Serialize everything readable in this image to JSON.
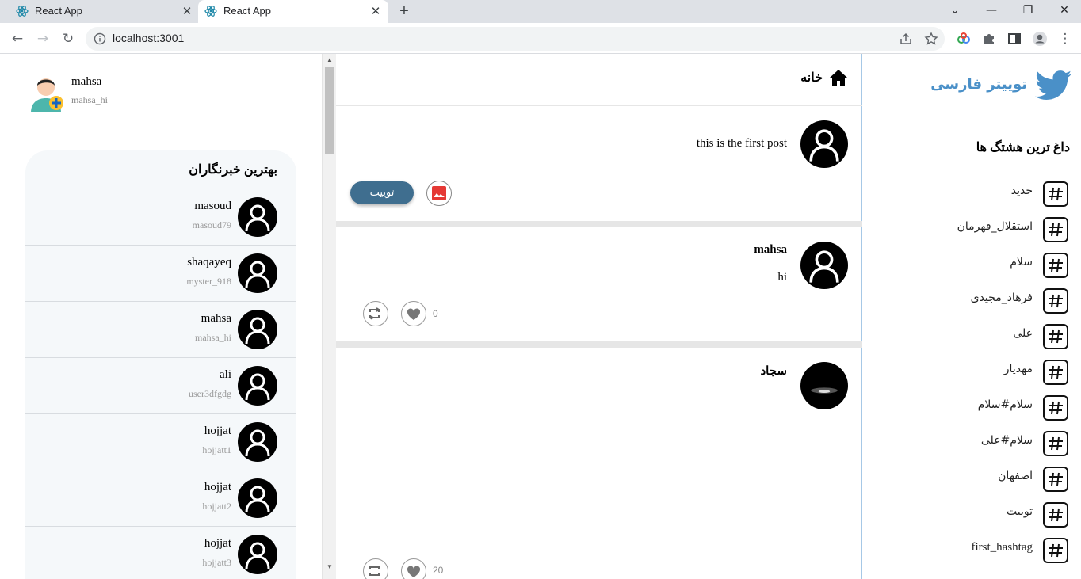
{
  "browser": {
    "tabs": [
      {
        "title": "React App",
        "active": false
      },
      {
        "title": "React App",
        "active": true
      }
    ],
    "new_tab_label": "+",
    "url": "localhost:3001"
  },
  "me": {
    "name": "mahsa",
    "handle": "mahsa_hi"
  },
  "writers": {
    "title": "بهترین خبرنگاران",
    "items": [
      {
        "name": "masoud",
        "handle": "masoud79"
      },
      {
        "name": "shaqayeq",
        "handle": "myster_918"
      },
      {
        "name": "mahsa",
        "handle": "mahsa_hi"
      },
      {
        "name": "ali",
        "handle": "user3dfgdg"
      },
      {
        "name": "hojjat",
        "handle": "hojjatt1"
      },
      {
        "name": "hojjat",
        "handle": "hojjatt2"
      },
      {
        "name": "hojjat",
        "handle": "hojjatt3"
      }
    ]
  },
  "feed": {
    "home_title": "خانه",
    "compose": {
      "text": "this is the first post",
      "tweet_button": "توییت"
    },
    "posts": [
      {
        "name": "mahsa",
        "text": "hi",
        "likes": "0"
      },
      {
        "name": "سجاد",
        "text": "",
        "likes": "20"
      }
    ]
  },
  "sidebar": {
    "brand": "توییتر فارسی",
    "tags_title": "داغ ترین هشتگ ها",
    "tags": [
      "جدید",
      "استقلال_قهرمان",
      "سلام",
      "فرهاد_مجیدی",
      "علی",
      "مهدیار",
      "سلام#سلام",
      "سلام#علی",
      "اصفهان",
      "توییت",
      "first_hashtag"
    ]
  },
  "colors": {
    "brand": "#4a90c8",
    "tweet_button": "#3f6e8f",
    "image_icon": "#e53935"
  }
}
